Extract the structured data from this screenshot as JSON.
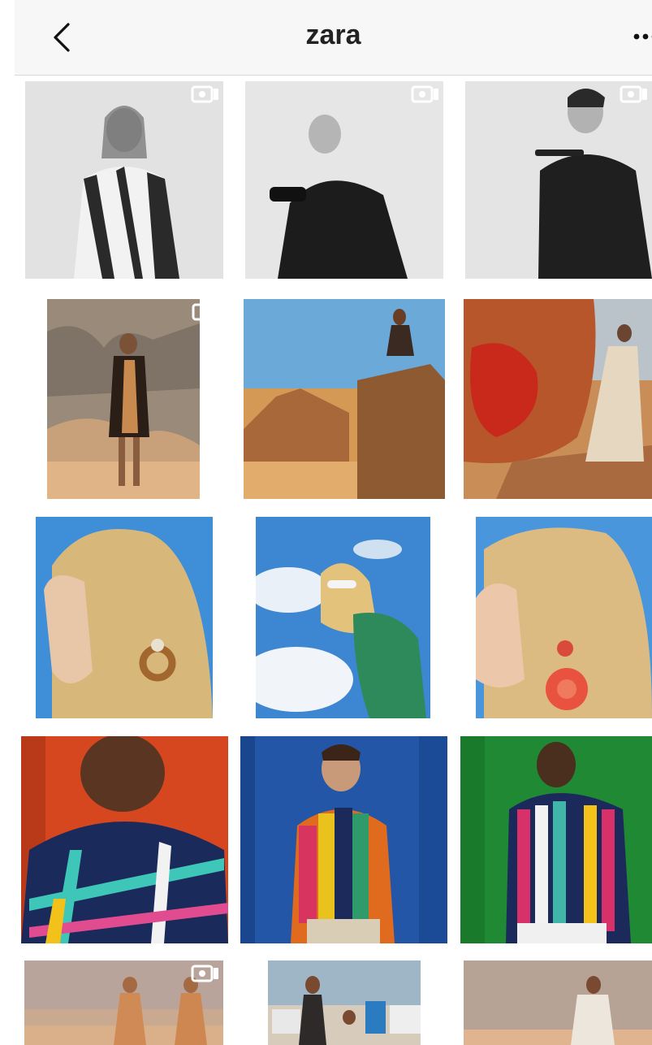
{
  "header": {
    "title": "zara",
    "back_icon": "chevron-left-icon",
    "more_icon": "more-horizontal-icon"
  },
  "grid": {
    "video_icon": "video-camera-icon",
    "posts": [
      {
        "row": 1,
        "col": 1,
        "content": "woman-striped-blazer-phone",
        "has_video_icon": true
      },
      {
        "row": 1,
        "col": 2,
        "content": "woman-black-shirt-phone",
        "has_video_icon": true
      },
      {
        "row": 1,
        "col": 3,
        "content": "man-black-shirt-phone",
        "has_video_icon": true
      },
      {
        "row": 2,
        "col": 1,
        "content": "woman-desert-rocks-dress",
        "has_video_icon": true
      },
      {
        "row": 2,
        "col": 2,
        "content": "woman-sitting-desert-rock",
        "has_video_icon": false
      },
      {
        "row": 2,
        "col": 3,
        "content": "woman-red-rock-desert",
        "has_video_icon": false
      },
      {
        "row": 3,
        "col": 1,
        "content": "blonde-woman-wooden-earring",
        "has_video_icon": false
      },
      {
        "row": 3,
        "col": 2,
        "content": "blonde-woman-sunglasses-sky",
        "has_video_icon": false
      },
      {
        "row": 3,
        "col": 3,
        "content": "blonde-woman-red-flower-earring",
        "has_video_icon": false
      },
      {
        "row": 4,
        "col": 1,
        "content": "man-back-plaid-shirt-red-wall",
        "has_video_icon": false
      },
      {
        "row": 4,
        "col": 2,
        "content": "man-striped-shirt-blue-curtain",
        "has_video_icon": false
      },
      {
        "row": 4,
        "col": 3,
        "content": "man-striped-shirt-green-wall",
        "has_video_icon": false
      },
      {
        "row": 5,
        "col": 1,
        "content": "two-women-beach-dresses",
        "has_video_icon": true
      },
      {
        "row": 5,
        "col": 2,
        "content": "women-beach-cabins",
        "has_video_icon": false
      },
      {
        "row": 5,
        "col": 3,
        "content": "woman-white-outfit-sand",
        "has_video_icon": false
      }
    ]
  },
  "colors": {
    "header_bg": "#f7f7f7",
    "studio_gray": "#e4e4e4",
    "desert_sand": "#d49a55",
    "sky_blue": "#3f8fd8"
  }
}
